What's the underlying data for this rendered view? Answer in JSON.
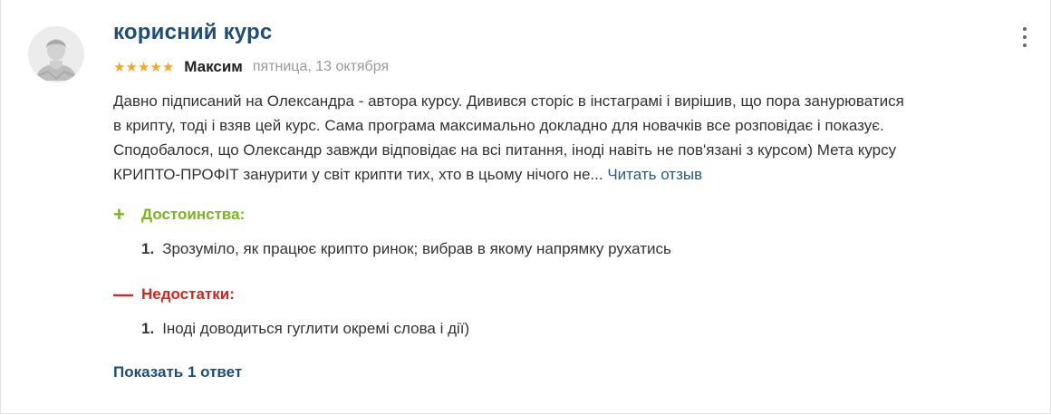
{
  "review": {
    "title": "корисний курс",
    "rating": 5,
    "stars_color": "#f5a623",
    "author": "Максим",
    "date": "пятница, 13 октября",
    "avatar_icon": "user-avatar-icon",
    "menu_icon": "more-vertical-icon",
    "text_lines": [
      "Давно підписаний на Олександра - автора курсу. Дивився сторіс в інстаграмі і вирішив, що пора занурюватися",
      "в крипту, тоді і взяв цей курс. Сама програма максимально докладно для новачків все розповідає і показує.",
      "Сподобалося, що Олександр завжди відповідає на всі питання, іноді навіть не пов'язані з курсом) Мета курсу",
      "КРИПТО-ПРОФІТ занурити у світ крипти тих, хто в цьому нічого не..."
    ],
    "read_more": "Читать отзыв",
    "pros": {
      "sign": "+",
      "label": "Достоинства:",
      "color": "#7ab51d",
      "items": [
        {
          "num": "1.",
          "text": "Зрозуміло, як працює крипто ринок; вибрав в якому напрямку рухатись"
        }
      ]
    },
    "cons": {
      "sign": "—",
      "label": "Недостатки:",
      "color": "#e0201b",
      "items": [
        {
          "num": "1.",
          "text": "Іноді доводиться гуглити окремі слова і дії)"
        }
      ]
    },
    "show_replies": "Показать 1 ответ",
    "accent_color": "#1f4d7a"
  }
}
